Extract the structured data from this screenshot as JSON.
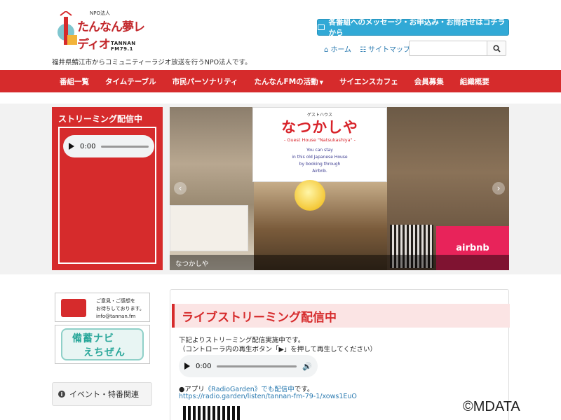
{
  "header": {
    "logo_npo": "NPO法人",
    "logo_brand": "たんなん夢レディオ",
    "logo_fm": "TANNAN FM79.1",
    "message_button": "各番組へのメッセージ・お申込み・お問合せはコチラから",
    "home_link": "ホーム",
    "sitemap_link": "サイトマップ",
    "search_placeholder": "",
    "tagline": "福井県鯖江市からコミュニティーラジオ放送を行うNPO法人です。"
  },
  "nav": {
    "items": [
      "番組一覧",
      "タイムテーブル",
      "市民パーソナリティ",
      "たんなんFMの活動",
      "サイエンスカフェ",
      "会員募集",
      "組織概要"
    ]
  },
  "streaming_box": {
    "title": "ストリーミング配信中",
    "time": "0:00"
  },
  "slider": {
    "sign_small": "ゲストハウス",
    "sign_title": "なつかしや",
    "sign_guest": "- Guest House \"Natsukashiya\" -",
    "sign_desc": [
      "You can stay",
      "in this old Japanese House",
      "by booking through",
      "Airbnb."
    ],
    "airbnb": "airbnb",
    "caption": "なつかしや",
    "colors": {
      "accent": "#d62b2c",
      "airbnb": "#e8235a"
    }
  },
  "sidebar": {
    "banner1_lines": [
      "ご意見・ご感想を",
      "お待ちしております。",
      "info@tannan.fm"
    ],
    "banner2_line1": "備蓄ナビ",
    "banner2_line2": "えちぜん",
    "event_label": "イベント・特番関連"
  },
  "main_panel": {
    "heading": "ライブストリーミング配信中",
    "text1": "下記よりストリーミング配信実施中です。",
    "text2": "（コントローラ内の再生ボタン「▶」を押して再生してください）",
    "player_time": "0:00",
    "app_prefix": "●アプリ",
    "app_link": "《RadioGarden》でも配信中",
    "app_suffix": "です。",
    "url": "https://radio.garden/listen/tannan-fm-79-1/xows1EuO"
  },
  "watermark": "©MDATA"
}
